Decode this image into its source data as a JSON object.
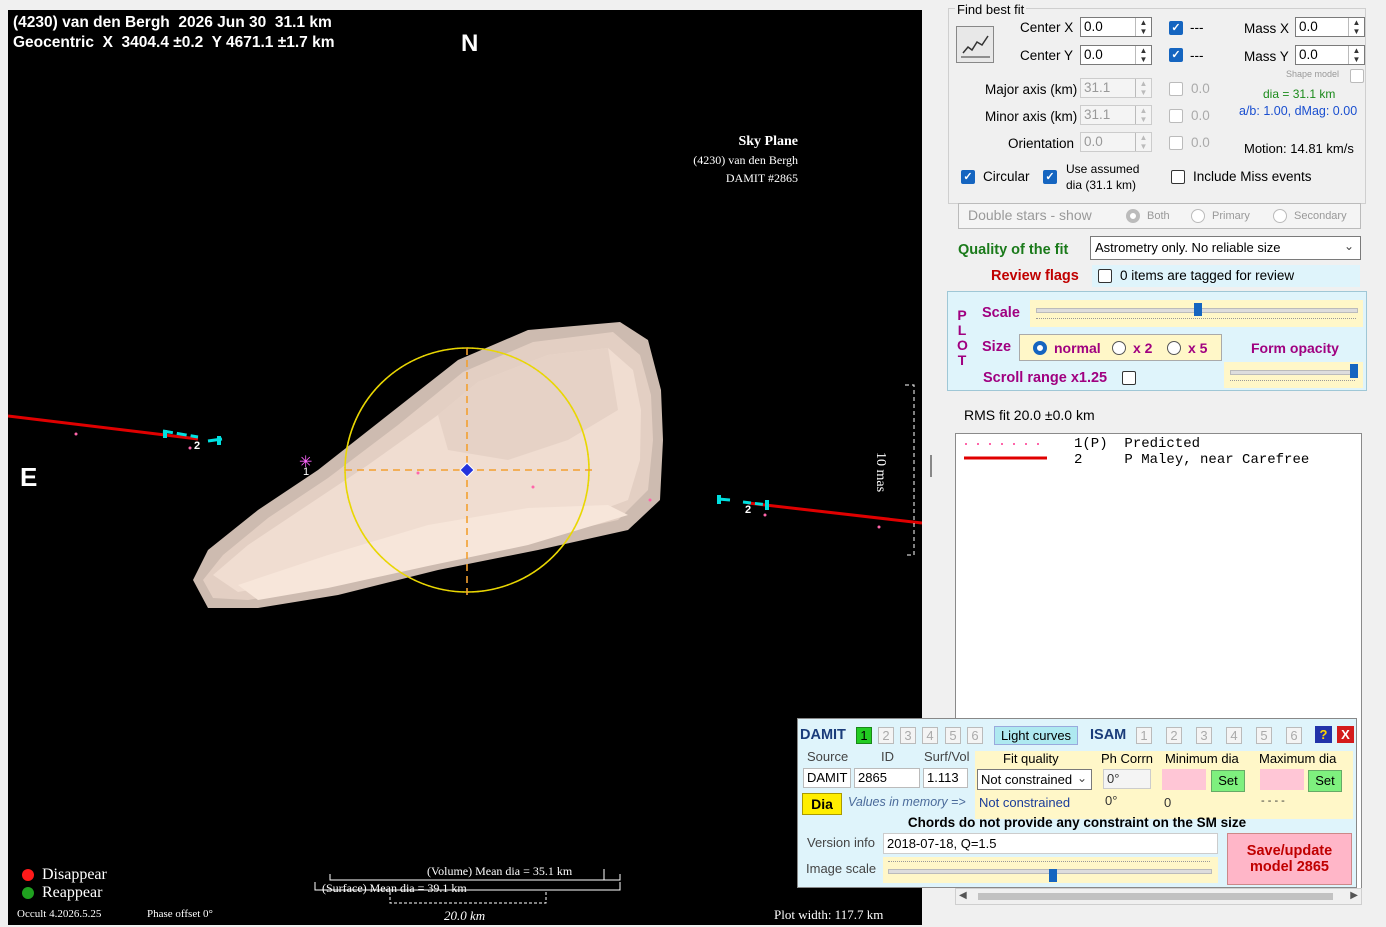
{
  "plot": {
    "header_line1": "(4230) van den Bergh  2026 Jun 30  31.1 km",
    "header_line2": "Geocentric  X  3404.4 ±0.2  Y 4671.1 ±1.7 km",
    "north": "N",
    "east": "E",
    "sky_plane_title": "Sky Plane",
    "sky_plane_object": "(4230) van den Bergh",
    "sky_plane_model": "DAMIT #2865",
    "scale_bar_label": "10 mas",
    "chord1_label": "1",
    "chord2_label_left": "2",
    "chord2_label_right": "2",
    "legend_disappear": "Disappear",
    "legend_reappear": "Reappear",
    "volume_mean_dia": "(Volume) Mean dia = 35.1 km",
    "surface_mean_dia": "(Surface) Mean dia = 39.1 km",
    "km_scale": "20.0 km",
    "version": "Occult 4.2026.5.25",
    "phase_offset": "Phase offset 0°",
    "plot_width": "Plot width: 117.7 km",
    "colors": {
      "disappear": "#ff1a1a",
      "reappear": "#1fa11f",
      "chord": "#e00000",
      "circle": "#e8d800",
      "model": "#f3ddd0"
    }
  },
  "fit": {
    "title": "Find best fit",
    "center_x_label": "Center X",
    "center_x": "0.0",
    "center_y_label": "Center Y",
    "center_y": "0.0",
    "dash": "---",
    "mass_x_label": "Mass X",
    "mass_x": "0.0",
    "mass_y_label": "Mass Y",
    "mass_y": "0.0",
    "shape_model_label": "Shape model",
    "major_label": "Major axis (km)",
    "major": "31.1",
    "major_unc": "0.0",
    "minor_label": "Minor axis (km)",
    "minor": "31.1",
    "minor_unc": "0.0",
    "orient_label": "Orientation",
    "orient": "0.0",
    "orient_unc": "0.0",
    "dia_info": "dia = 31.1 km",
    "ab_info": "a/b: 1.00, dMag: 0.00",
    "motion": "Motion: 14.81 km/s",
    "circular": "Circular",
    "use_assumed": "Use assumed",
    "use_assumed2": "dia (31.1 km)",
    "include_miss": "Include Miss events",
    "double_stars": "Double stars - show",
    "both": "Both",
    "primary": "Primary",
    "secondary": "Secondary",
    "quality_label": "Quality of the fit",
    "quality_value": "Astrometry only. No reliable size",
    "review_label": "Review flags",
    "review_value": "0 items are tagged for review"
  },
  "plotctl": {
    "plot_vertical": [
      "P",
      "L",
      "O",
      "T"
    ],
    "scale": "Scale",
    "size": "Size",
    "normal": "normal",
    "x2": "x 2",
    "x5": "x 5",
    "form_opacity": "Form opacity",
    "scroll_range": "Scroll range x1.25"
  },
  "rms": "RMS fit 20.0 ±0.0 km",
  "legend_list": [
    {
      "num": "1(P)",
      "text": "Predicted"
    },
    {
      "num": "2",
      "text": "P Maley, near Carefree"
    }
  ],
  "damit": {
    "damit_label": "DAMIT",
    "damit_nums": [
      "1",
      "2",
      "3",
      "4",
      "5",
      "6"
    ],
    "light_curves": "Light curves",
    "isam_label": "ISAM",
    "isam_nums": [
      "1",
      "2",
      "3",
      "4",
      "5",
      "6"
    ],
    "help": "?",
    "close": "X",
    "col_source": "Source",
    "col_id": "ID",
    "col_surf": "Surf/Vol",
    "col_fit": "Fit quality",
    "col_ph": "Ph Corrn",
    "col_min": "Minimum dia",
    "col_max": "Maximum dia",
    "source": "DAMIT",
    "id": "2865",
    "surf": "1.113",
    "fit_select": "Not constrained",
    "ph": "0°",
    "set": "Set",
    "dia_btn": "Dia",
    "values_in_memory": "Values in memory =>",
    "mem_fit": "Not constrained",
    "mem_ph": "0°",
    "mem_min": "0",
    "mem_max": "- - - -",
    "chords_note": "Chords do not provide any constraint on the SM size",
    "version_label": "Version info",
    "version_value": "2018-07-18, Q=1.5",
    "image_scale_label": "Image scale",
    "save_btn_line1": "Save/update",
    "save_btn_line2": "model 2865"
  }
}
